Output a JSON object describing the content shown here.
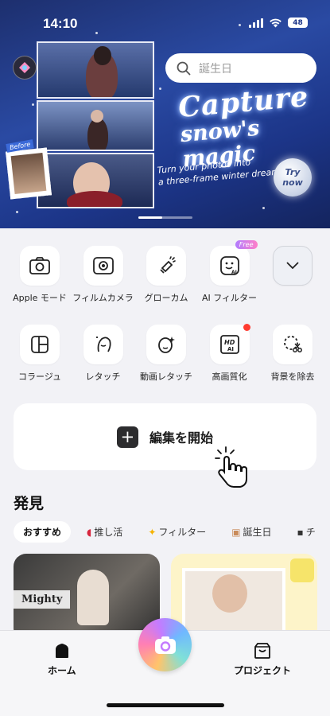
{
  "status_bar": {
    "time": "14:10",
    "battery": "48"
  },
  "search": {
    "placeholder": "誕生日"
  },
  "banner": {
    "headline_1": "Capture",
    "headline_2": "snow's magic",
    "subtitle_1": "Turn your photos into",
    "subtitle_2": "a three-frame winter dream",
    "cta": "Try now",
    "before_tag": "Before"
  },
  "tools_row1": [
    {
      "label": "Apple モード",
      "icon": "camera-icon"
    },
    {
      "label": "フィルムカメラ",
      "icon": "film-camera-icon"
    },
    {
      "label": "グローカム",
      "icon": "glow-cam-icon"
    },
    {
      "label": "AI フィルター",
      "icon": "ai-filter-icon",
      "badge": "Free"
    },
    {
      "label": "",
      "icon": "chevron-down-icon"
    }
  ],
  "tools_row2": [
    {
      "label": "コラージュ",
      "icon": "collage-icon"
    },
    {
      "label": "レタッチ",
      "icon": "retouch-icon"
    },
    {
      "label": "動画レタッチ",
      "icon": "video-retouch-icon"
    },
    {
      "label": "高画質化",
      "icon": "hd-ai-icon",
      "dot": true
    },
    {
      "label": "背景を除去",
      "icon": "remove-bg-icon"
    }
  ],
  "edit": {
    "label": "編集を開始"
  },
  "discover": {
    "title": "発見",
    "chips": [
      {
        "label": "おすすめ",
        "icon": ""
      },
      {
        "label": "推し活",
        "icon": "fan-icon"
      },
      {
        "label": "フィルター",
        "icon": "sparkle-icon"
      },
      {
        "label": "誕生日",
        "icon": "cake-icon"
      },
      {
        "label": "チ",
        "icon": "camera-icon"
      }
    ],
    "card1_text": "Mighty"
  },
  "nav": {
    "home": "ホーム",
    "projects": "プロジェクト"
  },
  "colors": {
    "hero_bg": "#1f3a8f",
    "accent_red": "#ff3b30"
  }
}
